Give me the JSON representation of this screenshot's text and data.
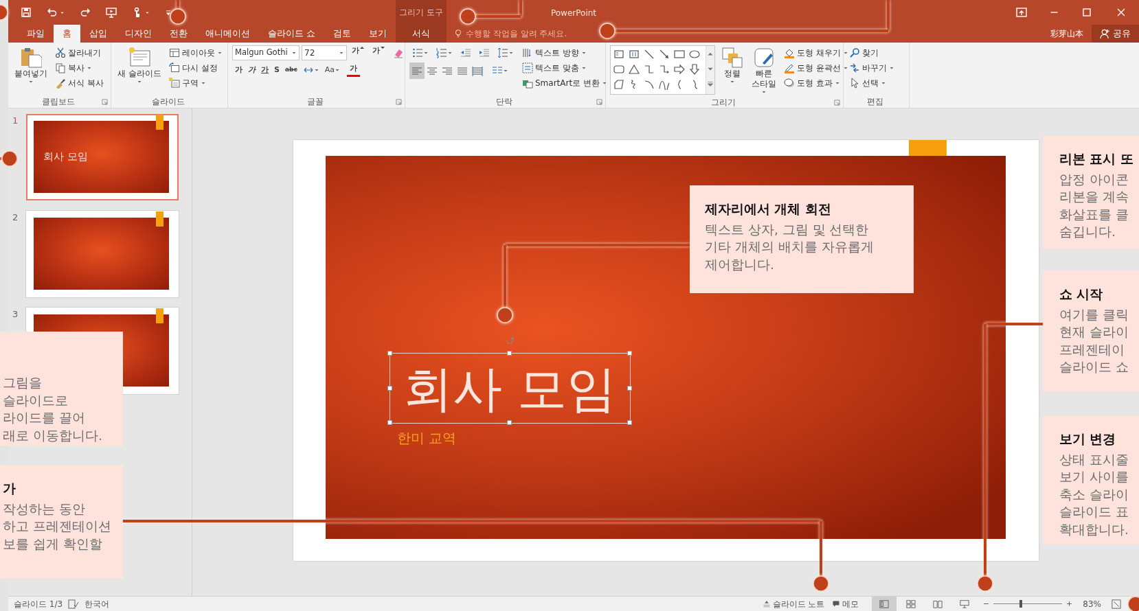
{
  "title_bar": {
    "context_label": "그리기 도구",
    "app_name": "PowerPoint"
  },
  "tabs": [
    {
      "label": "파일",
      "selected": false,
      "kind": "file"
    },
    {
      "label": "홈",
      "selected": true,
      "kind": "standard"
    },
    {
      "label": "삽입",
      "selected": false,
      "kind": "standard"
    },
    {
      "label": "디자인",
      "selected": false,
      "kind": "standard"
    },
    {
      "label": "전환",
      "selected": false,
      "kind": "standard"
    },
    {
      "label": "애니메이션",
      "selected": false,
      "kind": "standard"
    },
    {
      "label": "슬라이드 쇼",
      "selected": false,
      "kind": "standard"
    },
    {
      "label": "검토",
      "selected": false,
      "kind": "standard"
    },
    {
      "label": "보기",
      "selected": false,
      "kind": "standard"
    },
    {
      "label": "서식",
      "selected": false,
      "kind": "contextual"
    }
  ],
  "tell_me": {
    "placeholder": "수행할 작업을 알려 주세요."
  },
  "user_name": "彩芽山本",
  "share_button": "공유",
  "ribbon": {
    "clipboard": {
      "label": "클립보드",
      "paste": "붙여넣기",
      "items": [
        "잘라내기",
        "복사",
        "서식 복사"
      ]
    },
    "slides": {
      "label": "슬라이드",
      "new_slide": "새 슬라이드",
      "items": [
        "레이아웃",
        "다시 설정",
        "구역"
      ]
    },
    "font": {
      "label": "글꼴",
      "font_name": "Malgun Gothi",
      "font_size": "72",
      "size_buttons": [
        "가",
        "가"
      ],
      "format_buttons": [
        "가",
        "가",
        "가",
        "S",
        "abc"
      ],
      "case_button": "Aa",
      "color_button": "가"
    },
    "paragraph": {
      "label": "단락",
      "items": [
        "텍스트 방향",
        "텍스트 맞춤",
        "SmartArt로 변환"
      ],
      "alignments": [
        {
          "selected": true
        },
        {
          "selected": false
        },
        {
          "selected": false
        },
        {
          "selected": false
        },
        {
          "selected": false
        }
      ]
    },
    "drawing": {
      "label": "그리기",
      "arrange": "정렬",
      "quick_styles": "빠른 스타일",
      "items": [
        "도형 채우기",
        "도형 윤곽선",
        "도형 효과"
      ]
    },
    "editing": {
      "label": "편집",
      "items": [
        "찾기",
        "바꾸기",
        "선택"
      ]
    }
  },
  "thumbnails": [
    {
      "number": "1",
      "selected": true,
      "title": "회사 모임"
    },
    {
      "number": "2",
      "selected": false
    },
    {
      "number": "3",
      "selected": false
    }
  ],
  "slide": {
    "title": "회사 모임",
    "subtitle": "한미 교역"
  },
  "center_callout": {
    "title": "제자리에서 개체 회전",
    "lines": [
      "텍스트 상자, 그림 및 선택한",
      "기타 개체의 배치를 자유롭게",
      "제어합니다."
    ]
  },
  "right_callouts": [
    {
      "title": "리본 표시 또",
      "lines": [
        "압정 아이콘",
        "리본을 계속",
        "화살표를 클",
        "숨깁니다."
      ]
    },
    {
      "title": "쇼 시작",
      "lines": [
        "여기를 클릭",
        "현재 슬라이",
        "프레젠테이",
        "슬라이드 쇼"
      ]
    },
    {
      "title": "보기 변경",
      "lines": [
        "상태 표시줄",
        "보기 사이를",
        "축소 슬라이",
        "슬라이드 표",
        "확대합니다."
      ]
    }
  ],
  "left_callouts": [
    {
      "lines": [
        "그림을",
        "슬라이드로",
        "라이드를 끌어",
        "래로 이동합니다."
      ]
    },
    {
      "title": "가",
      "lines": [
        "작성하는 동안",
        "하고 프레젠테이션",
        "보를 쉽게 확인할"
      ]
    }
  ],
  "status_bar": {
    "slide_info": "슬라이드 1/3",
    "language": "한국어",
    "notes": "슬라이드 노트",
    "comments": "메모",
    "views": [
      {
        "selected": true
      },
      {
        "selected": false
      },
      {
        "selected": false
      },
      {
        "selected": false
      }
    ],
    "zoom": {
      "level": 0.4,
      "reading": "83%"
    }
  }
}
